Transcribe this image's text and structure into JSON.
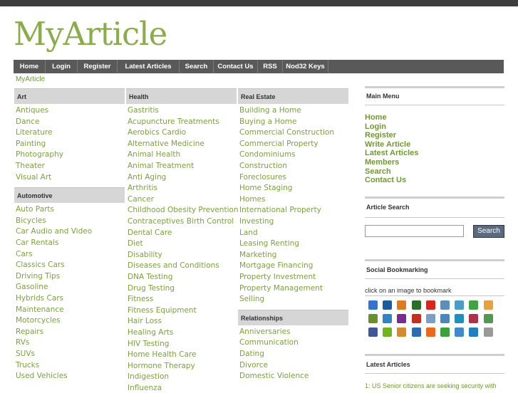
{
  "site": {
    "logo": "MyArticle",
    "breadcrumb": "MyArticle"
  },
  "nav": [
    "Home",
    "Login",
    "Register",
    "Latest Articles",
    "Search",
    "Contact Us",
    "RSS",
    "Nod32 Keys"
  ],
  "categories": {
    "col1": [
      {
        "heading": "Art",
        "items": [
          "Antiques",
          "Dance",
          "Literature",
          "Painting",
          "Photography",
          "Theater",
          "Visual Art"
        ]
      },
      {
        "heading": "Automotive",
        "items": [
          "Auto Parts",
          "Bicycles",
          "Car Audio and Video",
          "Car Rentals",
          "Cars",
          "Classics Cars",
          "Driving Tips",
          "Gasoline",
          "Hybrids Cars",
          "Maintenance",
          "Motorcycles",
          "Repairs",
          "RVs",
          "SUVs",
          "Trucks",
          "Used Vehicles"
        ]
      }
    ],
    "col2": [
      {
        "heading": "Health",
        "items": [
          "Gastritis",
          "Acupuncture Treatments",
          "Aerobics Cardio",
          "Alternative Medicine",
          "Animal Health",
          "Animal Treatment",
          "Anti Aging",
          "Arthritis",
          "Cancer",
          "Childhood Obesity Prevention",
          "Contraceptives Birth Control",
          "Dental Care",
          "Diet",
          "Disability",
          "Diseases and Conditions",
          "DNA Testing",
          "Drug Testing",
          "Fitness",
          "Fitness Equipment",
          "Hair Loss",
          "Healing Arts",
          "HIV Testing",
          "Home Health Care",
          "Hormone Therapy",
          "Indigestion",
          "Influenza"
        ]
      }
    ],
    "col3": [
      {
        "heading": "Real Estate",
        "items": [
          "Building a Home",
          "Buying a Home",
          "Commercial Construction",
          "Commercial Property",
          "Condominiums",
          "Construction",
          "Foreclosures",
          "Home Staging",
          "Homes",
          "International Property",
          "Investing",
          "Land",
          "Leasing Renting",
          "Marketing",
          "Mortgage Financing",
          "Property Investment",
          "Property Management",
          "Selling"
        ]
      },
      {
        "heading": "Relationships",
        "items": [
          "Anniversaries",
          "Communication",
          "Dating",
          "Divorce",
          "Domestic Violence"
        ]
      }
    ]
  },
  "sidebar": {
    "main_menu_title": "Main Menu",
    "main_menu": [
      "Home",
      "Login",
      "Register",
      "Write Article",
      "Latest Articles",
      "Members",
      "Search",
      "Contact Us"
    ],
    "search_title": "Article Search",
    "search_button": "Search",
    "social_title": "Social Bookmarking",
    "social_note": "click on an image to bookmark",
    "bookmark_icons": [
      {
        "name": "delicious-icon",
        "color": "#3274d1"
      },
      {
        "name": "digg-icon",
        "color": "#1b5c9e"
      },
      {
        "name": "spurl-icon",
        "color": "#e07a1f"
      },
      {
        "name": "wists-icon",
        "color": "#2a6e2a"
      },
      {
        "name": "simpy-icon",
        "color": "#d8261c"
      },
      {
        "name": "newsvine-icon",
        "color": "#5b8fb9"
      },
      {
        "name": "blinklist-icon",
        "color": "#4a9cc8"
      },
      {
        "name": "furl-icon",
        "color": "#3fa33f"
      },
      {
        "name": "reddit-icon",
        "color": "#e9a23b"
      },
      {
        "name": "fark-icon",
        "color": "#6b8f2a"
      },
      {
        "name": "blogmarks-icon",
        "color": "#2f83c7"
      },
      {
        "name": "yahoo-icon",
        "color": "#7a2b8f"
      },
      {
        "name": "smarking-icon",
        "color": "#c5301a"
      },
      {
        "name": "magnolia-icon",
        "color": "#7b9fc2"
      },
      {
        "name": "segnalo-icon",
        "color": "#4b86c0"
      },
      {
        "name": "netvouz-icon",
        "color": "#1f8fbf"
      },
      {
        "name": "comments-icon",
        "color": "#b22f4c"
      },
      {
        "name": "scuttle-icon",
        "color": "#4f9a4f"
      },
      {
        "name": "facebook-icon",
        "color": "#3b5998"
      },
      {
        "name": "stumble-icon",
        "color": "#6fb51e"
      },
      {
        "name": "sphinn-icon",
        "color": "#d88a2a"
      },
      {
        "name": "mixx-icon",
        "color": "#2b6cb3"
      },
      {
        "name": "propeller-icon",
        "color": "#e86a1a"
      },
      {
        "name": "buzz-icon",
        "color": "#3aa03a"
      },
      {
        "name": "hi5-icon",
        "color": "#3d8ad0"
      },
      {
        "name": "netlog-icon",
        "color": "#1f7fbf"
      },
      {
        "name": "misterwong-icon",
        "color": "#999999"
      }
    ],
    "latest_title": "Latest Articles",
    "latest_item": "1: US Senior citizens are seeking security with"
  }
}
